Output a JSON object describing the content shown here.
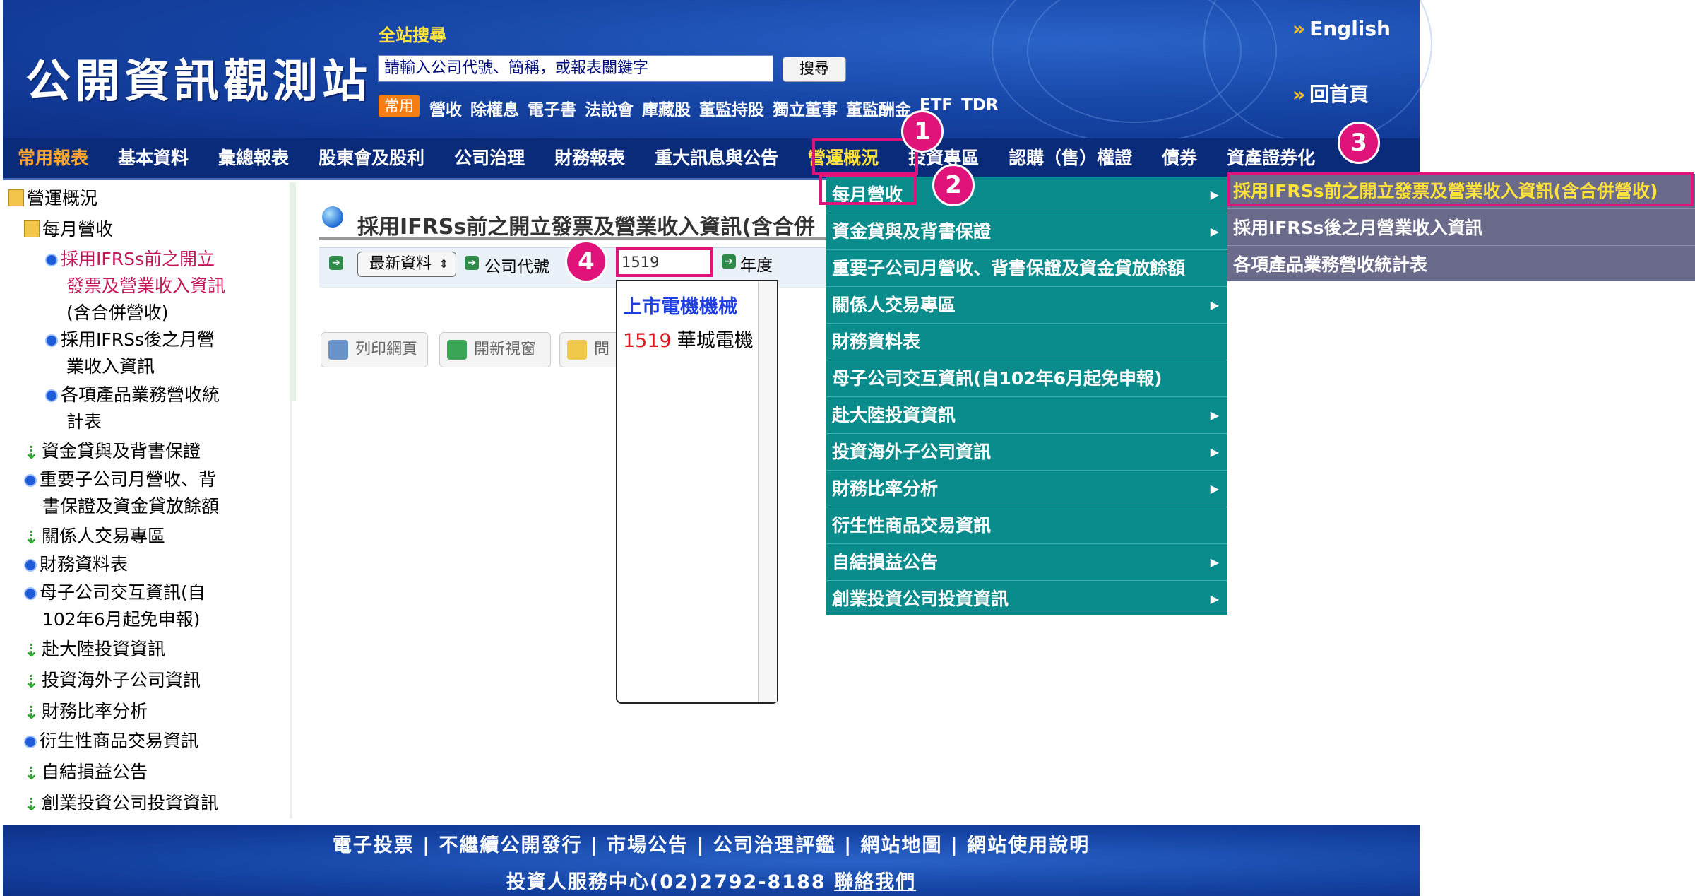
{
  "header": {
    "logo": "公開資訊觀測站",
    "search_title": "全站搜尋",
    "search_placeholder": "請輸入公司代號、簡稱，或報表關鍵字",
    "search_button": "搜尋",
    "common_badge": "常用",
    "quick_links": [
      "營收",
      "除權息",
      "電子書",
      "法說會",
      "庫藏股",
      "董監持股",
      "獨立董事",
      "董監酬金",
      "ETF",
      "TDR"
    ],
    "english": "English",
    "home": "回首頁"
  },
  "nav": {
    "items": [
      "常用報表",
      "基本資料",
      "彙總報表",
      "股東會及股利",
      "公司治理",
      "財務報表",
      "重大訊息與公告",
      "營運概況",
      "投資專區",
      "認購（售）權證",
      "債券",
      "資產證券化"
    ]
  },
  "tree": {
    "root": "營運概況",
    "monthly": "每月營收",
    "pre_ifrs": [
      "採用IFRSs前之開立",
      "發票及營業收入資訊",
      "(含合併營收)"
    ],
    "post_ifrs": [
      "採用IFRSs後之月營",
      "業收入資訊"
    ],
    "product_stats": [
      "各項產品業務營收統",
      "計表"
    ],
    "loans": "資金貸與及背書保證",
    "subsidiary": [
      "重要子公司月營收、背",
      "書保證及資金貸放餘額"
    ],
    "related_party": "關係人交易專區",
    "financial_table": "財務資料表",
    "parent_child": [
      "母子公司交互資訊(自",
      "102年6月起免申報)"
    ],
    "china": "赴大陸投資資訊",
    "overseas": "投資海外子公司資訊",
    "ratio": "財務比率分析",
    "derivatives": "衍生性商品交易資訊",
    "self_settlement": "自結損益公告",
    "venture": "創業投資公司投資資訊"
  },
  "content": {
    "title": "採用IFRSs前之開立發票及營業收入資訊(含合併",
    "market_select": "最新資料",
    "company_code_label": "公司代號",
    "company_code_value": "1519",
    "year_label": "年度",
    "tools": [
      "列印網頁",
      "開新視窗",
      "問題"
    ]
  },
  "autocomplete": {
    "group": "上市電機機械",
    "item_code": "1519",
    "item_name": "華城電機"
  },
  "menu": {
    "items": [
      "每月營收",
      "資金貸與及背書保證",
      "重要子公司月營收、背書保證及資金貸放餘額",
      "關係人交易專區",
      "財務資料表",
      "母子公司交互資訊(自102年6月起免申報)",
      "赴大陸投資資訊",
      "投資海外子公司資訊",
      "財務比率分析",
      "衍生性商品交易資訊",
      "自結損益公告",
      "創業投資公司投資資訊"
    ],
    "sub_items": [
      "採用IFRSs前之開立發票及營業收入資訊(含合併營收)",
      "採用IFRSs後之月營業收入資訊",
      "各項產品業務營收統計表"
    ]
  },
  "markers": [
    "1",
    "2",
    "3",
    "4"
  ],
  "footer": {
    "links": "電子投票 | 不繼續公開發行 | 市場公告 | 公司治理評鑑 | 網站地圖 | 網站使用說明",
    "contact_prefix": "投資人服務中心(02)2792-8188",
    "contact_link": "聯絡我們"
  },
  "colors": {
    "header_blue": "#1747a8",
    "nav_dark": "#0a2a7a",
    "menu_teal": "#0a8c8c",
    "submenu_gray": "#6a6a8a",
    "highlight_pink": "#e0137a",
    "accent_yellow": "#ffe23a"
  }
}
